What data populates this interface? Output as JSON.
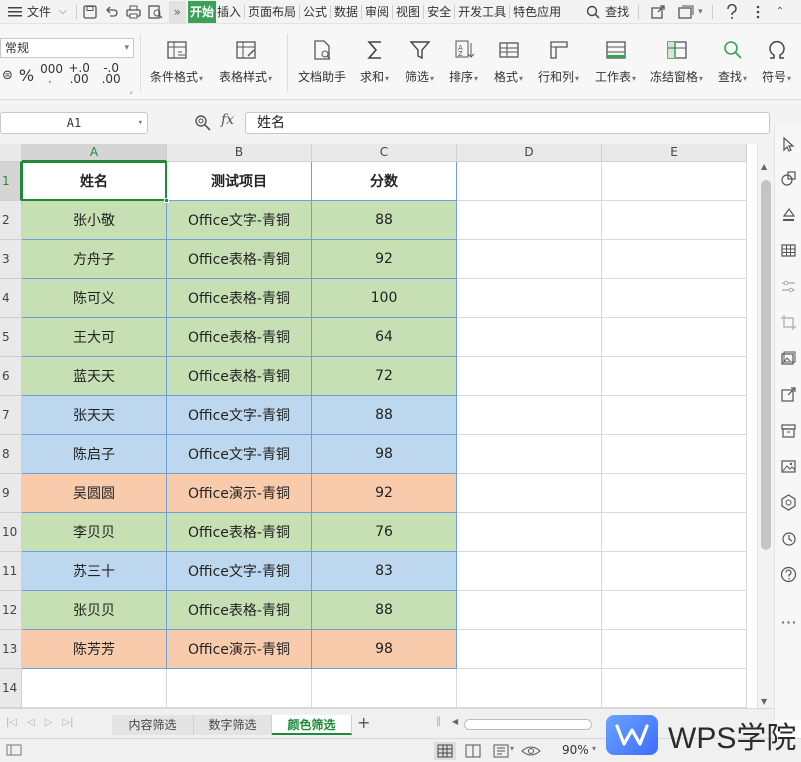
{
  "menubar": {
    "file_label": "文件",
    "tabs": [
      "开始",
      "插入",
      "页面布局",
      "公式",
      "数据",
      "审阅",
      "视图",
      "安全",
      "开发工具",
      "特色应用"
    ],
    "active_tab": "开始",
    "search_label": "查找",
    "help_icon": "help-icon"
  },
  "ribbon": {
    "number_format": "常规",
    "number_buttons": [
      "%",
      "000",
      "+.0 .00",
      "-.0 .00"
    ],
    "tools": [
      {
        "label": "条件格式",
        "icon": "conditional-format-icon",
        "dropdown": true
      },
      {
        "label": "表格样式",
        "icon": "table-style-icon",
        "dropdown": true
      },
      {
        "label": "文档助手",
        "icon": "document-assistant-icon",
        "dropdown": false
      },
      {
        "label": "求和",
        "icon": "sum-icon",
        "dropdown": true
      },
      {
        "label": "筛选",
        "icon": "filter-icon",
        "dropdown": true
      },
      {
        "label": "排序",
        "icon": "sort-icon",
        "dropdown": true
      },
      {
        "label": "格式",
        "icon": "format-icon",
        "dropdown": true
      },
      {
        "label": "行和列",
        "icon": "rows-columns-icon",
        "dropdown": true
      },
      {
        "label": "工作表",
        "icon": "worksheet-icon",
        "dropdown": true
      },
      {
        "label": "冻结窗格",
        "icon": "freeze-panes-icon",
        "dropdown": true
      },
      {
        "label": "查找",
        "icon": "find-icon",
        "dropdown": true
      },
      {
        "label": "符号",
        "icon": "symbol-icon",
        "dropdown": true
      }
    ]
  },
  "formula_bar": {
    "cell_ref": "A1",
    "fx_label": "fx",
    "content": "姓名"
  },
  "sheet": {
    "columns": [
      "A",
      "B",
      "C",
      "D",
      "E"
    ],
    "row_numbers": [
      "1",
      "2",
      "3",
      "4",
      "5",
      "6",
      "7",
      "8",
      "9",
      "10",
      "11",
      "12",
      "13",
      "14"
    ],
    "header": [
      "姓名",
      "测试项目",
      "分数"
    ],
    "rows": [
      {
        "name": "张小敬",
        "project": "Office文字-青铜",
        "score": "88",
        "color": "green"
      },
      {
        "name": "方舟子",
        "project": "Office表格-青铜",
        "score": "92",
        "color": "green"
      },
      {
        "name": "陈可义",
        "project": "Office表格-青铜",
        "score": "100",
        "color": "green"
      },
      {
        "name": "王大可",
        "project": "Office表格-青铜",
        "score": "64",
        "color": "green"
      },
      {
        "name": "蓝天天",
        "project": "Office表格-青铜",
        "score": "72",
        "color": "green"
      },
      {
        "name": "张天天",
        "project": "Office文字-青铜",
        "score": "88",
        "color": "blue"
      },
      {
        "name": "陈启子",
        "project": "Office文字-青铜",
        "score": "98",
        "color": "blue"
      },
      {
        "name": "吴圆圆",
        "project": "Office演示-青铜",
        "score": "92",
        "color": "orange"
      },
      {
        "name": "李贝贝",
        "project": "Office表格-青铜",
        "score": "76",
        "color": "green"
      },
      {
        "name": "苏三十",
        "project": "Office文字-青铜",
        "score": "83",
        "color": "blue"
      },
      {
        "name": "张贝贝",
        "project": "Office表格-青铜",
        "score": "88",
        "color": "green"
      },
      {
        "name": "陈芳芳",
        "project": "Office演示-青铜",
        "score": "98",
        "color": "orange"
      }
    ],
    "fill_colors": {
      "green": "#c6e0b4",
      "blue": "#bdd7ee",
      "orange": "#f8cbad"
    },
    "active_cell": "A1"
  },
  "tabs": {
    "sheets": [
      "内容筛选",
      "数字筛选",
      "颜色筛选"
    ],
    "active_sheet": "颜色筛选",
    "add_label": "+"
  },
  "status": {
    "zoom": "90%"
  },
  "watermark": {
    "text": "WPS学院"
  },
  "colors": {
    "accent": "#1f8a3b",
    "active_tab_bg": "#39a158"
  }
}
